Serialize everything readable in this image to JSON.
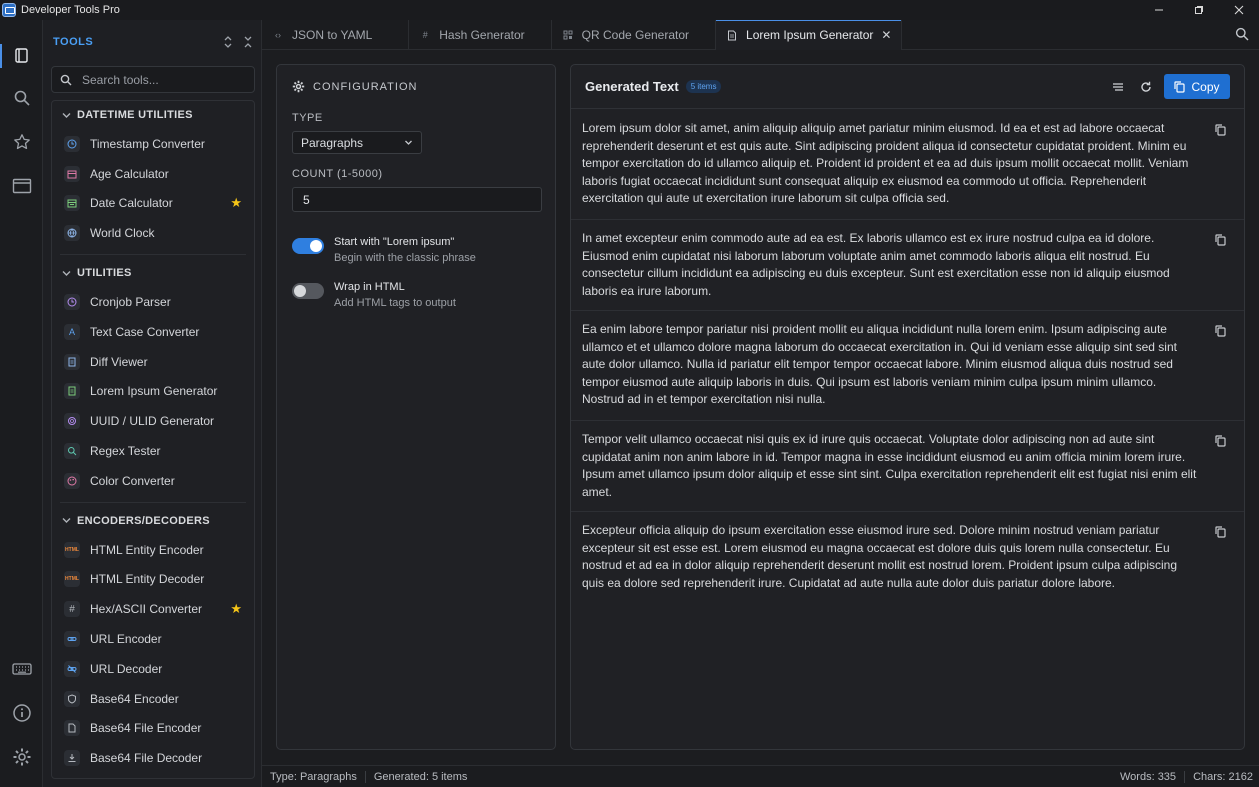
{
  "window": {
    "title": "Developer Tools Pro"
  },
  "sidebar": {
    "title": "TOOLS",
    "search_placeholder": "Search tools...",
    "groups": [
      {
        "label": "DATETIME UTILITIES",
        "items": [
          {
            "label": "Timestamp Converter",
            "icon": "clock-icon",
            "favorite": false
          },
          {
            "label": "Age Calculator",
            "icon": "calendar-icon",
            "favorite": false
          },
          {
            "label": "Date Calculator",
            "icon": "calendar-calc-icon",
            "favorite": true
          },
          {
            "label": "World Clock",
            "icon": "globe-icon",
            "favorite": false
          }
        ]
      },
      {
        "label": "UTILITIES",
        "items": [
          {
            "label": "Cronjob Parser",
            "icon": "clock-icon",
            "favorite": false
          },
          {
            "label": "Text Case Converter",
            "icon": "text-case-icon",
            "favorite": false
          },
          {
            "label": "Diff Viewer",
            "icon": "diff-icon",
            "favorite": false
          },
          {
            "label": "Lorem Ipsum Generator",
            "icon": "document-icon",
            "favorite": false
          },
          {
            "label": "UUID / ULID Generator",
            "icon": "fingerprint-icon",
            "favorite": false
          },
          {
            "label": "Regex Tester",
            "icon": "search-icon",
            "favorite": false
          },
          {
            "label": "Color Converter",
            "icon": "palette-icon",
            "favorite": false
          }
        ]
      },
      {
        "label": "ENCODERS/DECODERS",
        "items": [
          {
            "label": "HTML Entity Encoder",
            "icon": "html-icon",
            "favorite": false
          },
          {
            "label": "HTML Entity Decoder",
            "icon": "html-icon",
            "favorite": false
          },
          {
            "label": "Hex/ASCII Converter",
            "icon": "hash-icon",
            "favorite": true
          },
          {
            "label": "URL Encoder",
            "icon": "link-icon",
            "favorite": false
          },
          {
            "label": "URL Decoder",
            "icon": "unlink-icon",
            "favorite": false
          },
          {
            "label": "Base64 Encoder",
            "icon": "shield-icon",
            "favorite": false
          },
          {
            "label": "Base64 File Encoder",
            "icon": "file-icon",
            "favorite": false
          },
          {
            "label": "Base64 File Decoder",
            "icon": "download-icon",
            "favorite": false
          }
        ]
      }
    ]
  },
  "tabs": [
    {
      "label": "JSON to YAML",
      "icon": "code-icon",
      "active": false
    },
    {
      "label": "Hash Generator",
      "icon": "hash-icon",
      "active": false
    },
    {
      "label": "QR Code Generator",
      "icon": "qr-icon",
      "active": false
    },
    {
      "label": "Lorem Ipsum Generator",
      "icon": "document-icon",
      "active": true
    }
  ],
  "config": {
    "title": "CONFIGURATION",
    "type_label": "TYPE",
    "type_value": "Paragraphs",
    "count_label": "COUNT (1-5000)",
    "count_value": "5",
    "toggles": [
      {
        "title": "Start with \"Lorem ipsum\"",
        "subtitle": "Begin with the classic phrase",
        "on": true
      },
      {
        "title": "Wrap in HTML",
        "subtitle": "Add HTML tags to output",
        "on": false
      }
    ]
  },
  "output": {
    "title": "Generated Text",
    "badge": "5 items",
    "copy_label": "Copy",
    "paragraphs": [
      "Lorem ipsum dolor sit amet, anim aliquip aliquip amet pariatur minim eiusmod. Id ea et est ad labore occaecat reprehenderit deserunt et est quis aute. Sint adipiscing proident aliqua id consectetur cupidatat proident. Minim eu tempor exercitation do id ullamco aliquip et. Proident id proident et ea ad duis ipsum mollit occaecat mollit. Veniam laboris fugiat occaecat incididunt sunt consequat aliquip ex eiusmod ea commodo ut officia. Reprehenderit exercitation qui aute ut exercitation irure laborum sit culpa officia sed.",
      "In amet excepteur enim commodo aute ad ea est. Ex laboris ullamco est ex irure nostrud culpa ea id dolore. Eiusmod enim cupidatat nisi laborum laborum voluptate anim amet commodo laboris aliqua elit nostrud. Eu consectetur cillum incididunt ea adipiscing eu duis excepteur. Sunt est exercitation esse non id aliquip eiusmod laboris ea irure laborum.",
      "Ea enim labore tempor pariatur nisi proident mollit eu aliqua incididunt nulla lorem enim. Ipsum adipiscing aute ullamco et et ullamco dolore magna laborum do occaecat exercitation in. Qui id veniam esse aliquip sint sed sint aute dolor ullamco. Nulla id pariatur elit tempor tempor occaecat labore. Minim eiusmod aliqua duis nostrud sed tempor eiusmod aute aliquip laboris in duis. Qui ipsum est laboris veniam minim culpa ipsum minim ullamco. Nostrud ad in et tempor exercitation nisi nulla.",
      "Tempor velit ullamco occaecat nisi quis ex id irure quis occaecat. Voluptate dolor adipiscing non ad aute sint cupidatat anim non anim labore in id. Tempor magna in esse incididunt eiusmod eu anim officia minim lorem irure. Ipsum amet ullamco ipsum dolor aliquip et esse sint sint. Culpa exercitation reprehenderit elit est fugiat nisi enim elit amet.",
      "Excepteur officia aliquip do ipsum exercitation esse eiusmod irure sed. Dolore minim nostrud veniam pariatur excepteur sit est esse est. Lorem eiusmod eu magna occaecat est dolore duis quis lorem nulla consectetur. Eu nostrud et ad ea in dolor aliquip reprehenderit deserunt mollit est nostrud lorem. Proident ipsum culpa adipiscing quis ea dolore sed reprehenderit irure. Cupidatat ad aute nulla aute dolor duis pariatur dolore labore."
    ]
  },
  "status": {
    "type": "Type: Paragraphs",
    "generated": "Generated: 5 items",
    "words": "Words: 335",
    "chars": "Chars: 2162"
  },
  "colors": {
    "accent": "#1f6fd1",
    "star": "#f5c518",
    "tools_title": "#4a9ff5"
  }
}
